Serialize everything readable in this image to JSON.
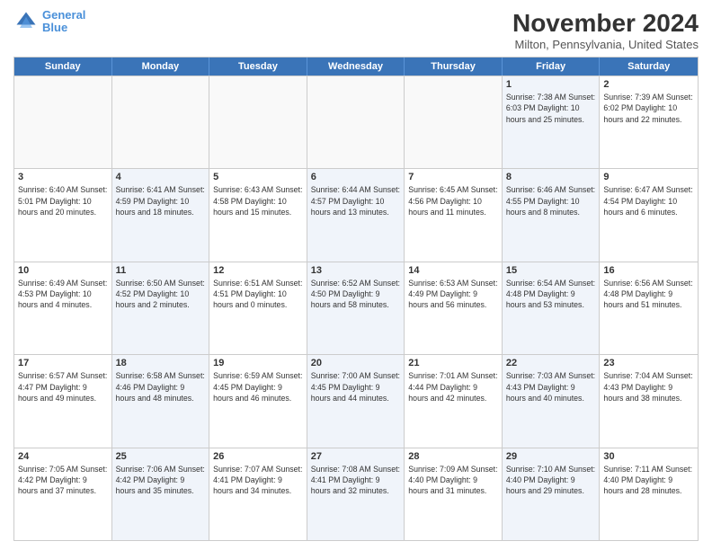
{
  "header": {
    "logo_line1": "General",
    "logo_line2": "Blue",
    "month_title": "November 2024",
    "subtitle": "Milton, Pennsylvania, United States"
  },
  "weekdays": [
    "Sunday",
    "Monday",
    "Tuesday",
    "Wednesday",
    "Thursday",
    "Friday",
    "Saturday"
  ],
  "rows": [
    [
      {
        "day": "",
        "info": "",
        "empty": true
      },
      {
        "day": "",
        "info": "",
        "empty": true
      },
      {
        "day": "",
        "info": "",
        "empty": true
      },
      {
        "day": "",
        "info": "",
        "empty": true
      },
      {
        "day": "",
        "info": "",
        "empty": true
      },
      {
        "day": "1",
        "info": "Sunrise: 7:38 AM\nSunset: 6:03 PM\nDaylight: 10 hours and 25 minutes.",
        "alt": true
      },
      {
        "day": "2",
        "info": "Sunrise: 7:39 AM\nSunset: 6:02 PM\nDaylight: 10 hours and 22 minutes.",
        "alt": false
      }
    ],
    [
      {
        "day": "3",
        "info": "Sunrise: 6:40 AM\nSunset: 5:01 PM\nDaylight: 10 hours and 20 minutes.",
        "alt": false
      },
      {
        "day": "4",
        "info": "Sunrise: 6:41 AM\nSunset: 4:59 PM\nDaylight: 10 hours and 18 minutes.",
        "alt": true
      },
      {
        "day": "5",
        "info": "Sunrise: 6:43 AM\nSunset: 4:58 PM\nDaylight: 10 hours and 15 minutes.",
        "alt": false
      },
      {
        "day": "6",
        "info": "Sunrise: 6:44 AM\nSunset: 4:57 PM\nDaylight: 10 hours and 13 minutes.",
        "alt": true
      },
      {
        "day": "7",
        "info": "Sunrise: 6:45 AM\nSunset: 4:56 PM\nDaylight: 10 hours and 11 minutes.",
        "alt": false
      },
      {
        "day": "8",
        "info": "Sunrise: 6:46 AM\nSunset: 4:55 PM\nDaylight: 10 hours and 8 minutes.",
        "alt": true
      },
      {
        "day": "9",
        "info": "Sunrise: 6:47 AM\nSunset: 4:54 PM\nDaylight: 10 hours and 6 minutes.",
        "alt": false
      }
    ],
    [
      {
        "day": "10",
        "info": "Sunrise: 6:49 AM\nSunset: 4:53 PM\nDaylight: 10 hours and 4 minutes.",
        "alt": false
      },
      {
        "day": "11",
        "info": "Sunrise: 6:50 AM\nSunset: 4:52 PM\nDaylight: 10 hours and 2 minutes.",
        "alt": true
      },
      {
        "day": "12",
        "info": "Sunrise: 6:51 AM\nSunset: 4:51 PM\nDaylight: 10 hours and 0 minutes.",
        "alt": false
      },
      {
        "day": "13",
        "info": "Sunrise: 6:52 AM\nSunset: 4:50 PM\nDaylight: 9 hours and 58 minutes.",
        "alt": true
      },
      {
        "day": "14",
        "info": "Sunrise: 6:53 AM\nSunset: 4:49 PM\nDaylight: 9 hours and 56 minutes.",
        "alt": false
      },
      {
        "day": "15",
        "info": "Sunrise: 6:54 AM\nSunset: 4:48 PM\nDaylight: 9 hours and 53 minutes.",
        "alt": true
      },
      {
        "day": "16",
        "info": "Sunrise: 6:56 AM\nSunset: 4:48 PM\nDaylight: 9 hours and 51 minutes.",
        "alt": false
      }
    ],
    [
      {
        "day": "17",
        "info": "Sunrise: 6:57 AM\nSunset: 4:47 PM\nDaylight: 9 hours and 49 minutes.",
        "alt": false
      },
      {
        "day": "18",
        "info": "Sunrise: 6:58 AM\nSunset: 4:46 PM\nDaylight: 9 hours and 48 minutes.",
        "alt": true
      },
      {
        "day": "19",
        "info": "Sunrise: 6:59 AM\nSunset: 4:45 PM\nDaylight: 9 hours and 46 minutes.",
        "alt": false
      },
      {
        "day": "20",
        "info": "Sunrise: 7:00 AM\nSunset: 4:45 PM\nDaylight: 9 hours and 44 minutes.",
        "alt": true
      },
      {
        "day": "21",
        "info": "Sunrise: 7:01 AM\nSunset: 4:44 PM\nDaylight: 9 hours and 42 minutes.",
        "alt": false
      },
      {
        "day": "22",
        "info": "Sunrise: 7:03 AM\nSunset: 4:43 PM\nDaylight: 9 hours and 40 minutes.",
        "alt": true
      },
      {
        "day": "23",
        "info": "Sunrise: 7:04 AM\nSunset: 4:43 PM\nDaylight: 9 hours and 38 minutes.",
        "alt": false
      }
    ],
    [
      {
        "day": "24",
        "info": "Sunrise: 7:05 AM\nSunset: 4:42 PM\nDaylight: 9 hours and 37 minutes.",
        "alt": false
      },
      {
        "day": "25",
        "info": "Sunrise: 7:06 AM\nSunset: 4:42 PM\nDaylight: 9 hours and 35 minutes.",
        "alt": true
      },
      {
        "day": "26",
        "info": "Sunrise: 7:07 AM\nSunset: 4:41 PM\nDaylight: 9 hours and 34 minutes.",
        "alt": false
      },
      {
        "day": "27",
        "info": "Sunrise: 7:08 AM\nSunset: 4:41 PM\nDaylight: 9 hours and 32 minutes.",
        "alt": true
      },
      {
        "day": "28",
        "info": "Sunrise: 7:09 AM\nSunset: 4:40 PM\nDaylight: 9 hours and 31 minutes.",
        "alt": false
      },
      {
        "day": "29",
        "info": "Sunrise: 7:10 AM\nSunset: 4:40 PM\nDaylight: 9 hours and 29 minutes.",
        "alt": true
      },
      {
        "day": "30",
        "info": "Sunrise: 7:11 AM\nSunset: 4:40 PM\nDaylight: 9 hours and 28 minutes.",
        "alt": false
      }
    ]
  ]
}
